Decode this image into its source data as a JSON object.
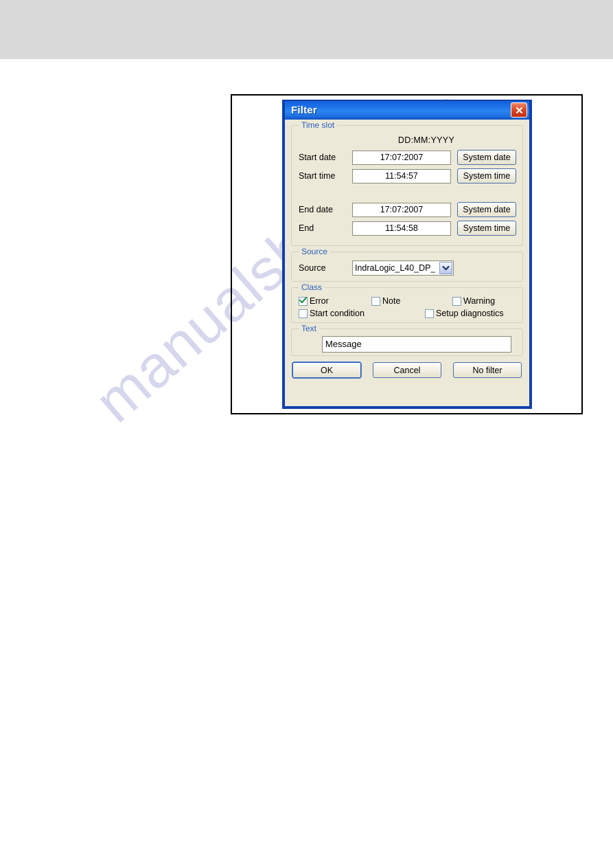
{
  "page": {
    "watermark": "manualshive.com"
  },
  "dialog": {
    "title": "Filter",
    "close_icon": "close-icon",
    "groups": {
      "time_slot": {
        "legend": "Time slot",
        "format_hint": "DD:MM:YYYY",
        "rows": [
          {
            "label": "Start date",
            "value": "17:07:2007",
            "button": "System date"
          },
          {
            "label": "Start time",
            "value": "11:54:57",
            "button": "System time"
          },
          {
            "label": "End date",
            "value": "17:07:2007",
            "button": "System date"
          },
          {
            "label": "End",
            "value": "11:54:58",
            "button": "System time"
          }
        ]
      },
      "source": {
        "legend": "Source",
        "label": "Source",
        "value": "IndraLogic_L40_DP_",
        "arrow_icon": "chevron-down-icon"
      },
      "class": {
        "legend": "Class",
        "items": [
          {
            "label": "Error",
            "checked": true
          },
          {
            "label": "Note",
            "checked": false
          },
          {
            "label": "Warning",
            "checked": false
          },
          {
            "label": "Start condition",
            "checked": false
          },
          {
            "label": "Setup diagnostics",
            "checked": false
          }
        ]
      },
      "text": {
        "legend": "Text",
        "value": "Message"
      }
    },
    "footer": {
      "ok": "OK",
      "cancel": "Cancel",
      "no_filter": "No filter"
    }
  },
  "colors": {
    "titlebar": "#1c73e8",
    "dialog_face": "#ece9d8",
    "legend": "#2b5fbd",
    "close": "#e04a28",
    "check": "#169044",
    "band": "#d9d9d9"
  }
}
